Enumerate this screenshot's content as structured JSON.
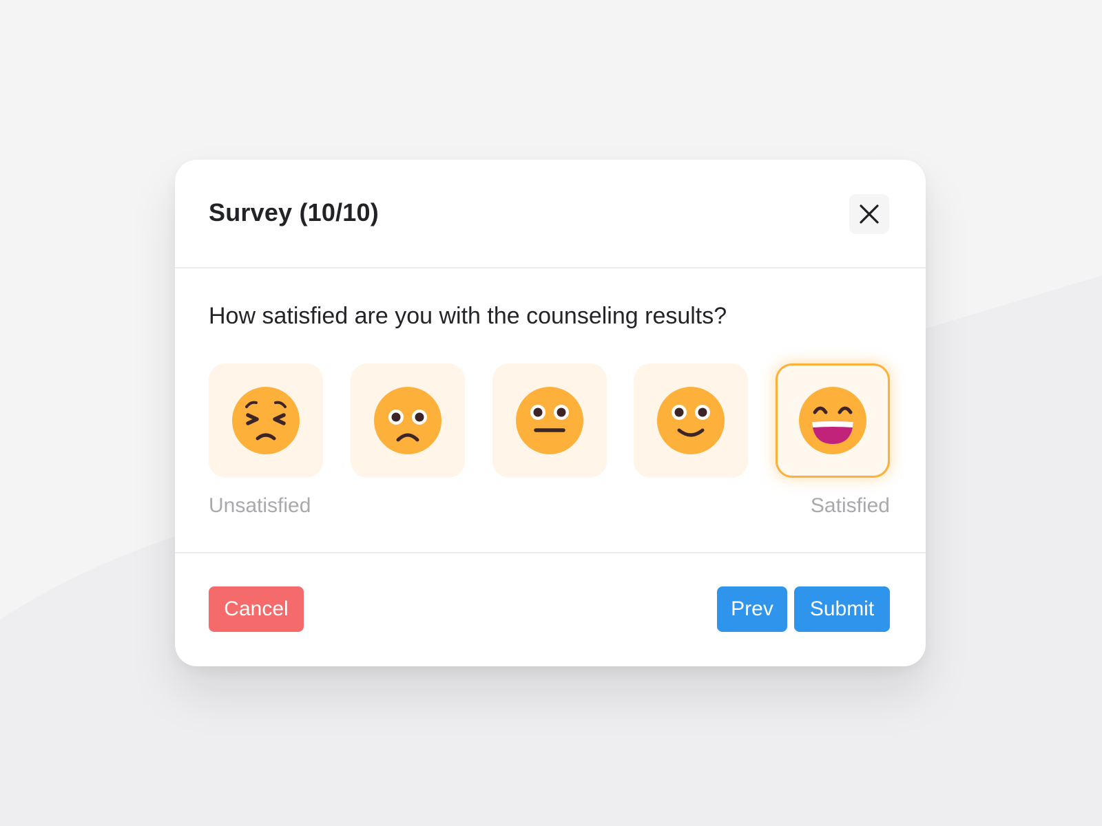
{
  "modal": {
    "title": "Survey (10/10)",
    "close_icon": "close-icon"
  },
  "question": {
    "text": "How satisfied are you with the counseling results?"
  },
  "rating": {
    "options": [
      {
        "icon": "persevering-face-icon",
        "selected": false
      },
      {
        "icon": "frowning-face-icon",
        "selected": false
      },
      {
        "icon": "neutral-face-icon",
        "selected": false
      },
      {
        "icon": "slightly-smiling-face-icon",
        "selected": false
      },
      {
        "icon": "grinning-face-icon",
        "selected": true
      }
    ],
    "min_label": "Unsatisfied",
    "max_label": "Satisfied",
    "selected_value": 5,
    "scale_max": 5
  },
  "footer": {
    "cancel_label": "Cancel",
    "prev_label": "Prev",
    "submit_label": "Submit"
  },
  "colors": {
    "face": "#fdb03a",
    "feature": "#3d2527",
    "mouth": "#c2237a",
    "cancel": "#f56b6b",
    "primary": "#2f95ec",
    "selected_border": "#fdb03a"
  }
}
